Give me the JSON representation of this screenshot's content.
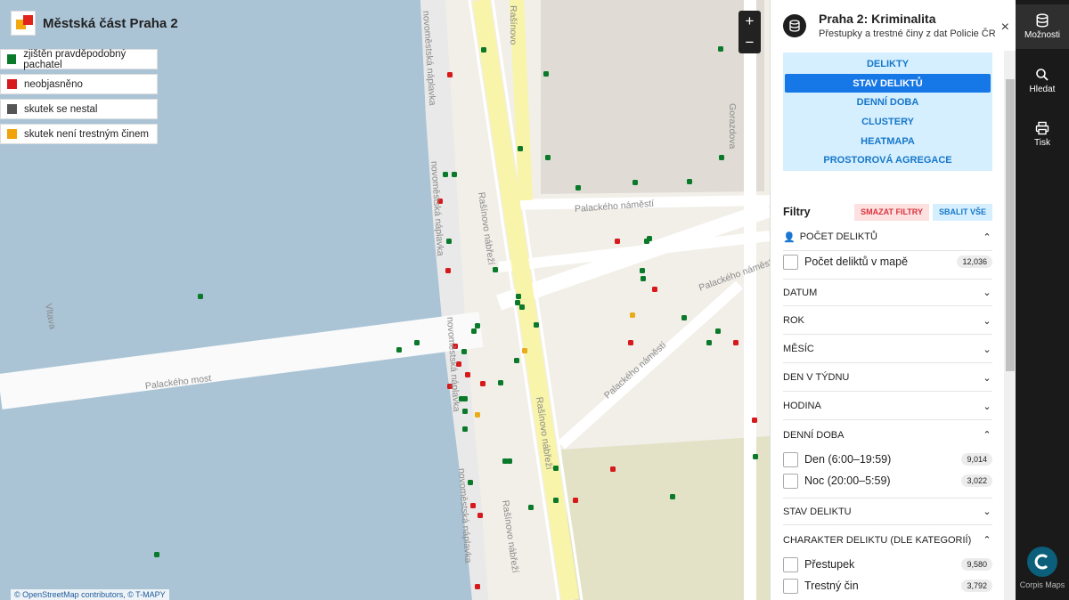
{
  "brand": {
    "title": "Městská část Praha 2"
  },
  "legend": [
    {
      "label": "zjištěn pravděpodobný pachatel",
      "color": "#0a7a2a"
    },
    {
      "label": "neobjasněno",
      "color": "#d7191c"
    },
    {
      "label": "skutek se nestal",
      "color": "#555555"
    },
    {
      "label": "skutek není trestným činem",
      "color": "#f0a30a"
    }
  ],
  "map": {
    "zoom_in": "+",
    "zoom_out": "−",
    "attribution": "© OpenStreetMap contributors, © T-MAPY",
    "street_labels": [
      "novoměstská náplavka",
      "novoměstská náplavka",
      "novoměstská náplavka",
      "novoměstská náplavka",
      "Rašínovo nábřeží",
      "Rašínovo nábřeží",
      "Rašínovo nábřeží",
      "Palackého most",
      "Palackého náměstí",
      "Palackého náměstí",
      "Palackého náměstí",
      "Gorazdova",
      "Vltava",
      "Rašínovo"
    ]
  },
  "panel": {
    "title": "Praha 2: Kriminalita",
    "subtitle": "Přestupky a trestné činy z dat Policie ČR",
    "close": "×",
    "tabs": [
      "DELIKTY",
      "STAV DELIKTŮ",
      "DENNÍ DOBA",
      "CLUSTERY",
      "HEATMAPA",
      "PROSTOROVÁ AGREGACE"
    ],
    "active_tab": "STAV DELIKTŮ",
    "filters_label": "Filtry",
    "clear_filters": "SMAZAT FILTRY",
    "collapse_all": "SBALIT VŠE",
    "sections": [
      {
        "label": "POČET DELIKTŮ",
        "expanded": true,
        "icon": "person-icon"
      },
      {
        "label": "DATUM",
        "expanded": false
      },
      {
        "label": "ROK",
        "expanded": false
      },
      {
        "label": "MĚSÍC",
        "expanded": false
      },
      {
        "label": "DEN V TÝDNU",
        "expanded": false
      },
      {
        "label": "HODINA",
        "expanded": false
      },
      {
        "label": "DENNÍ DOBA",
        "expanded": true
      },
      {
        "label": "STAV DELIKTU",
        "expanded": false
      },
      {
        "label": "CHARAKTER DELIKTU (DLE KATEGORIÍ)",
        "expanded": true
      }
    ],
    "options": {
      "pocet": {
        "label": "Počet deliktů v mapě",
        "count": "12,036"
      },
      "den": {
        "label": "Den (6:00–19:59)",
        "count": "9,014"
      },
      "noc": {
        "label": "Noc (20:00–5:59)",
        "count": "3,022"
      },
      "prestupek": {
        "label": "Přestupek",
        "count": "9,580"
      },
      "trestny": {
        "label": "Trestný čin",
        "count": "3,792"
      }
    }
  },
  "sidebar": {
    "items": [
      {
        "label": "Možnosti",
        "icon": "database-icon"
      },
      {
        "label": "Hledat",
        "icon": "search-icon"
      },
      {
        "label": "Tisk",
        "icon": "print-icon"
      }
    ],
    "footer": "Corpis Maps"
  }
}
